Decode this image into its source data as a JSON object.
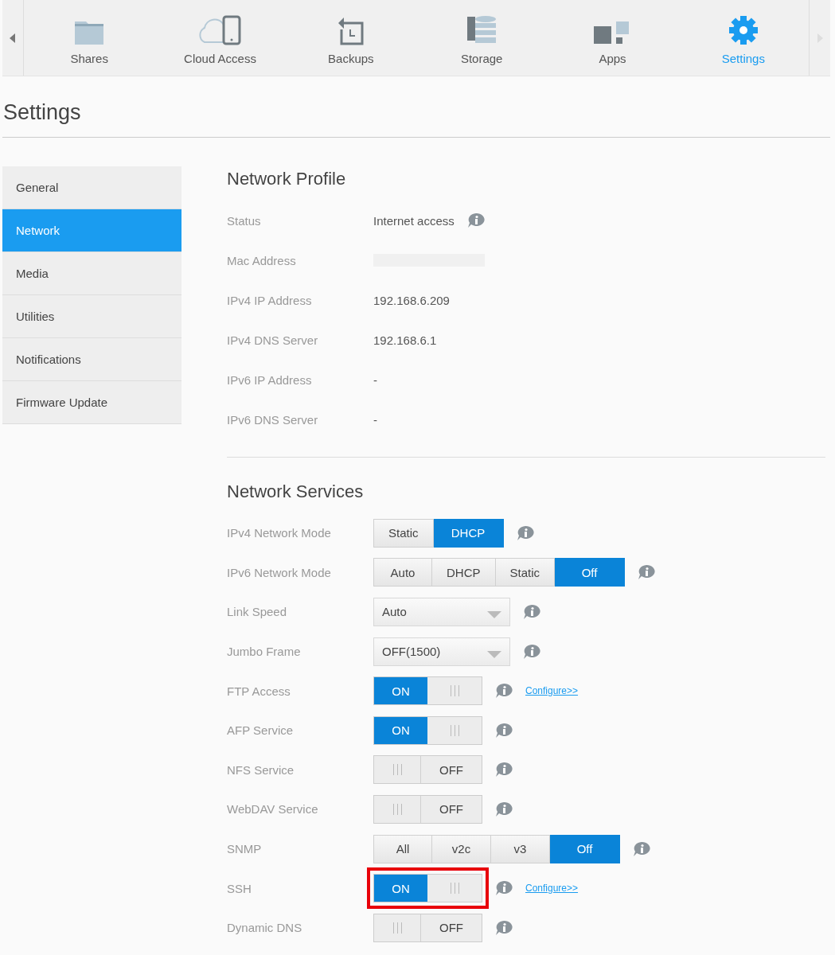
{
  "nav": {
    "items": [
      {
        "label": "Shares",
        "selected": false
      },
      {
        "label": "Cloud Access",
        "selected": false
      },
      {
        "label": "Backups",
        "selected": false
      },
      {
        "label": "Storage",
        "selected": false
      },
      {
        "label": "Apps",
        "selected": false
      },
      {
        "label": "Settings",
        "selected": true
      }
    ]
  },
  "page_title": "Settings",
  "sidebar": {
    "items": [
      {
        "label": "General",
        "selected": false
      },
      {
        "label": "Network",
        "selected": true
      },
      {
        "label": "Media",
        "selected": false
      },
      {
        "label": "Utilities",
        "selected": false
      },
      {
        "label": "Notifications",
        "selected": false
      },
      {
        "label": "Firmware Update",
        "selected": false
      }
    ]
  },
  "profile": {
    "title": "Network Profile",
    "rows": [
      {
        "label": "Status",
        "value": "Internet access",
        "info": true
      },
      {
        "label": "Mac Address",
        "redacted": true
      },
      {
        "label": "IPv4 IP Address",
        "value": "192.168.6.209"
      },
      {
        "label": "IPv4 DNS Server",
        "value": "192.168.6.1"
      },
      {
        "label": "IPv6 IP Address",
        "value": "-"
      },
      {
        "label": "IPv6 DNS Server",
        "value": "-"
      }
    ]
  },
  "services": {
    "title": "Network Services",
    "rows": [
      {
        "label": "IPv4 Network Mode",
        "kind": "segmented",
        "options": [
          {
            "label": "Static",
            "selected": false
          },
          {
            "label": "DHCP",
            "selected": true
          }
        ]
      },
      {
        "label": "IPv6 Network Mode",
        "kind": "segmented",
        "options": [
          {
            "label": "Auto",
            "selected": false
          },
          {
            "label": "DHCP",
            "selected": false
          },
          {
            "label": "Static",
            "selected": false
          },
          {
            "label": "Off",
            "selected": true
          }
        ]
      },
      {
        "label": "Link Speed",
        "kind": "dropdown",
        "value": "Auto"
      },
      {
        "label": "Jumbo Frame",
        "kind": "dropdown",
        "value": "OFF(1500)"
      },
      {
        "label": "FTP Access",
        "kind": "toggle",
        "on": true,
        "state_text": "ON",
        "link": "Configure>>"
      },
      {
        "label": "AFP Service",
        "kind": "toggle",
        "on": true,
        "state_text": "ON"
      },
      {
        "label": "NFS Service",
        "kind": "toggle",
        "on": false,
        "state_text": "OFF"
      },
      {
        "label": "WebDAV Service",
        "kind": "toggle",
        "on": false,
        "state_text": "OFF"
      },
      {
        "label": "SNMP",
        "kind": "segmented",
        "options": [
          {
            "label": "All",
            "selected": false
          },
          {
            "label": "v2c",
            "selected": false
          },
          {
            "label": "v3",
            "selected": false
          },
          {
            "label": "Off",
            "selected": true
          }
        ]
      },
      {
        "label": "SSH",
        "kind": "toggle",
        "on": true,
        "state_text": "ON",
        "link": "Configure>>",
        "highlighted": true
      },
      {
        "label": "Dynamic DNS",
        "kind": "toggle",
        "on": false,
        "state_text": "OFF"
      }
    ]
  }
}
